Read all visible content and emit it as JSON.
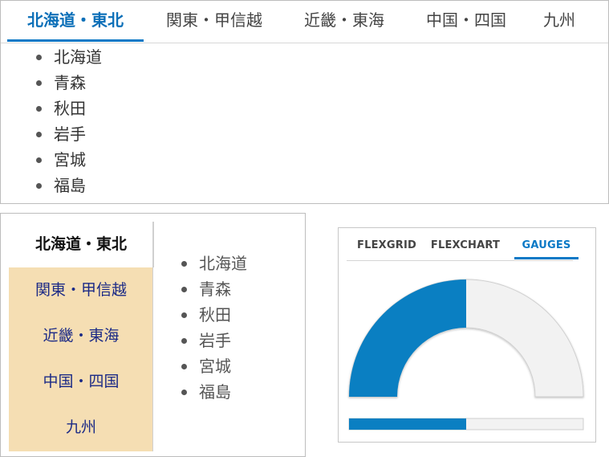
{
  "tab_labels": [
    "北海道・東北",
    "関東・甲信越",
    "近畿・東海",
    "中国・四国",
    "九州"
  ],
  "prefectures": [
    "北海道",
    "青森",
    "秋田",
    "岩手",
    "宮城",
    "福島"
  ],
  "gauge_tabs": [
    "FLEXGRID",
    "FLEXCHART",
    "GAUGES"
  ],
  "gauge": {
    "value_fraction": 0.5
  },
  "colors": {
    "accent": "#0b79c6",
    "vertical_tab_bg": "#f5deb3",
    "vertical_tab_text": "#1b2a86",
    "gauge_fill": "#0a7fc2",
    "gauge_track": "#f2f2f2"
  }
}
